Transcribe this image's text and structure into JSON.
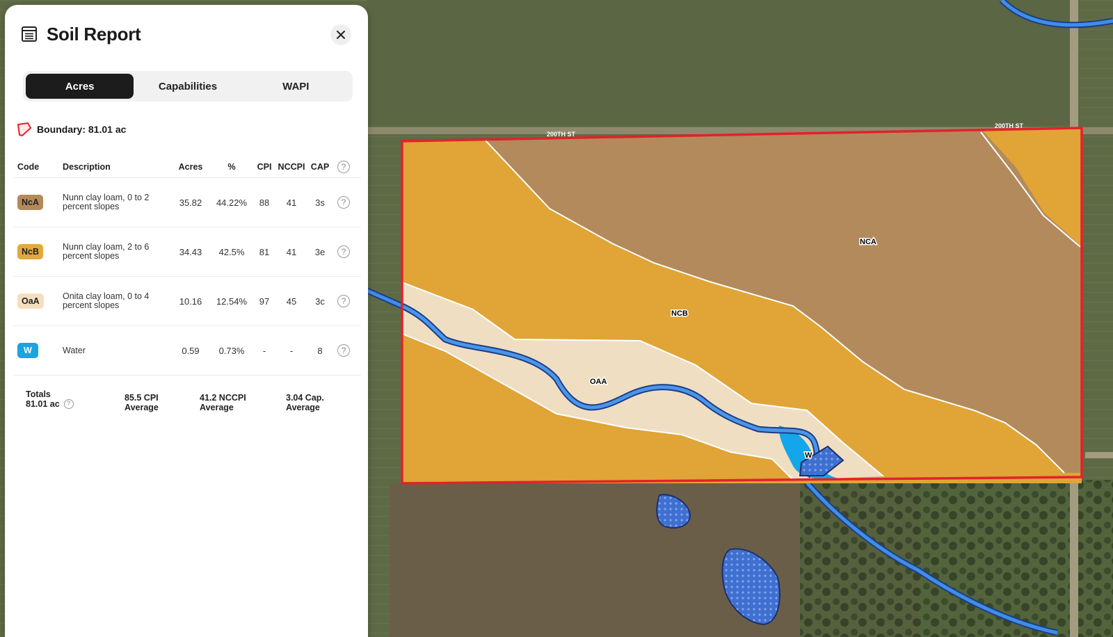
{
  "panel": {
    "title": "Soil Report",
    "close_icon": "close-icon",
    "tabs": [
      {
        "label": "Acres",
        "active": true
      },
      {
        "label": "Capabilities",
        "active": false
      },
      {
        "label": "WAPI",
        "active": false
      }
    ],
    "boundary_label": "Boundary: 81.01 ac"
  },
  "table": {
    "headers": {
      "code": "Code",
      "description": "Description",
      "acres": "Acres",
      "percent": "%",
      "cpi": "CPI",
      "nccpi": "NCCPI",
      "cap": "CAP"
    },
    "rows": [
      {
        "code": "NcA",
        "color": "#b48a5a",
        "description": "Nunn clay loam, 0 to 2 percent slopes",
        "acres": "35.82",
        "percent": "44.22%",
        "cpi": "88",
        "nccpi": "41",
        "cap": "3s"
      },
      {
        "code": "NcB",
        "color": "#e3a93c",
        "description": "Nunn clay loam, 2 to 6 percent slopes",
        "acres": "34.43",
        "percent": "42.5%",
        "cpi": "81",
        "nccpi": "41",
        "cap": "3e"
      },
      {
        "code": "OaA",
        "color": "#f6dfbf",
        "description": "Onita clay loam, 0 to 4 percent slopes",
        "acres": "10.16",
        "percent": "12.54%",
        "cpi": "97",
        "nccpi": "45",
        "cap": "3c"
      },
      {
        "code": "W",
        "color": "#1aa4e0",
        "description": "Water",
        "acres": "0.59",
        "percent": "0.73%",
        "cpi": "-",
        "nccpi": "-",
        "cap": "8"
      }
    ],
    "totals": {
      "label": "Totals",
      "acres": "81.01 ac",
      "cpi_value": "85.5 CPI",
      "cpi_label": "Average",
      "nccpi_value": "41.2 NCCPI",
      "nccpi_label": "Average",
      "cap_value": "3.04 Cap.",
      "cap_label": "Average"
    }
  },
  "map": {
    "labels": {
      "nca": "NCA",
      "ncb": "NCB",
      "oaa": "OAA",
      "w": "W",
      "road_left": "200TH ST",
      "road_right": "200TH ST"
    },
    "colors": {
      "boundary": "#e3212b",
      "nca": "#b48a5a",
      "ncb": "#e3a93c",
      "oaa": "#f2e1c6",
      "water": "#1f8be0"
    }
  }
}
